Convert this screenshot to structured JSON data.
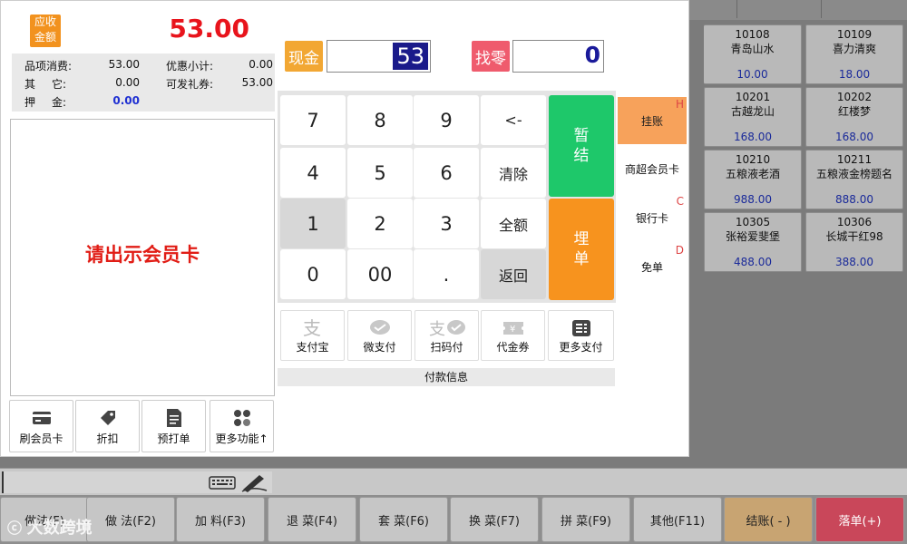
{
  "products": [
    {
      "code": "10108",
      "name": "青岛山水",
      "price": "10.00"
    },
    {
      "code": "10109",
      "name": "喜力清爽",
      "price": "18.00"
    },
    {
      "code": "10201",
      "name": "古越龙山",
      "price": "168.00"
    },
    {
      "code": "10202",
      "name": "红楼梦",
      "price": "168.00"
    },
    {
      "code": "10210",
      "name": "五粮液老酒",
      "price": "988.00"
    },
    {
      "code": "10211",
      "name": "五粮液金榜题名",
      "price": "888.00"
    },
    {
      "code": "10305",
      "name": "张裕爱斐堡",
      "price": "488.00"
    },
    {
      "code": "10306",
      "name": "长城干红98",
      "price": "388.00"
    }
  ],
  "summary": {
    "due_label_1": "应收",
    "due_label_2": "金额",
    "due_amount": "53.00",
    "items_label": "品项消费:",
    "items_value": "53.00",
    "discount_label": "优惠小计:",
    "discount_value": "0.00",
    "other_label_1": "其",
    "other_label_2": "它:",
    "other_value": "0.00",
    "giftcard_label": "可发礼券:",
    "giftcard_value": "53.00",
    "deposit_label_1": "押",
    "deposit_label_2": "金:",
    "deposit_value": "0.00"
  },
  "member_prompt": "请出示会员卡",
  "left_actions": [
    {
      "label": "刷会员卡",
      "icon": "card-icon"
    },
    {
      "label": "折扣",
      "icon": "tag-icon"
    },
    {
      "label": "预打单",
      "icon": "document-icon"
    },
    {
      "label": "更多功能↑",
      "icon": "apps-icon"
    }
  ],
  "cash": {
    "label": "现金",
    "value": "53"
  },
  "change": {
    "label": "找零",
    "value": "0"
  },
  "keypad": {
    "k7": "7",
    "k8": "8",
    "k9": "9",
    "back": "<-",
    "k4": "4",
    "k5": "5",
    "k6": "6",
    "clear": "清除",
    "k1": "1",
    "k2": "2",
    "k3": "3",
    "full": "全额",
    "k0": "0",
    "k00": "00",
    "dot": ".",
    "ret": "返回"
  },
  "hold_button": "暂\n结",
  "checkout_button": "埋\n单",
  "side_methods": [
    {
      "label": "挂账",
      "key": "H"
    },
    {
      "label": "商超会员卡",
      "key": ""
    },
    {
      "label": "银行卡",
      "key": "C"
    },
    {
      "label": "免单",
      "key": "D"
    }
  ],
  "payment_methods": [
    {
      "label": "支付宝",
      "icon": "alipay-icon"
    },
    {
      "label": "微支付",
      "icon": "wechat-pay-icon"
    },
    {
      "label": "扫码付",
      "icon": "scan-pay-icon"
    },
    {
      "label": "代金券",
      "icon": "voucher-icon"
    },
    {
      "label": "更多支付",
      "icon": "more-payment-icon"
    }
  ],
  "payment_info_label": "付款信息",
  "fkeys": [
    {
      "label": "做法(F)"
    },
    {
      "label": "做 法(F2)"
    },
    {
      "label": "加 料(F3)"
    },
    {
      "label": "退 菜(F4)"
    },
    {
      "label": "套 菜(F6)"
    },
    {
      "label": "换 菜(F7)"
    },
    {
      "label": "拼 菜(F9)"
    },
    {
      "label": "其他(F11)"
    },
    {
      "label": "结账( - )"
    },
    {
      "label": "落单(+)"
    }
  ],
  "watermark": "大数跨境",
  "colors": {
    "accent_orange": "#f2921e",
    "green": "#1ec86a",
    "red": "#e8141c",
    "checkout": "#c8a472",
    "order": "#c9475a"
  }
}
